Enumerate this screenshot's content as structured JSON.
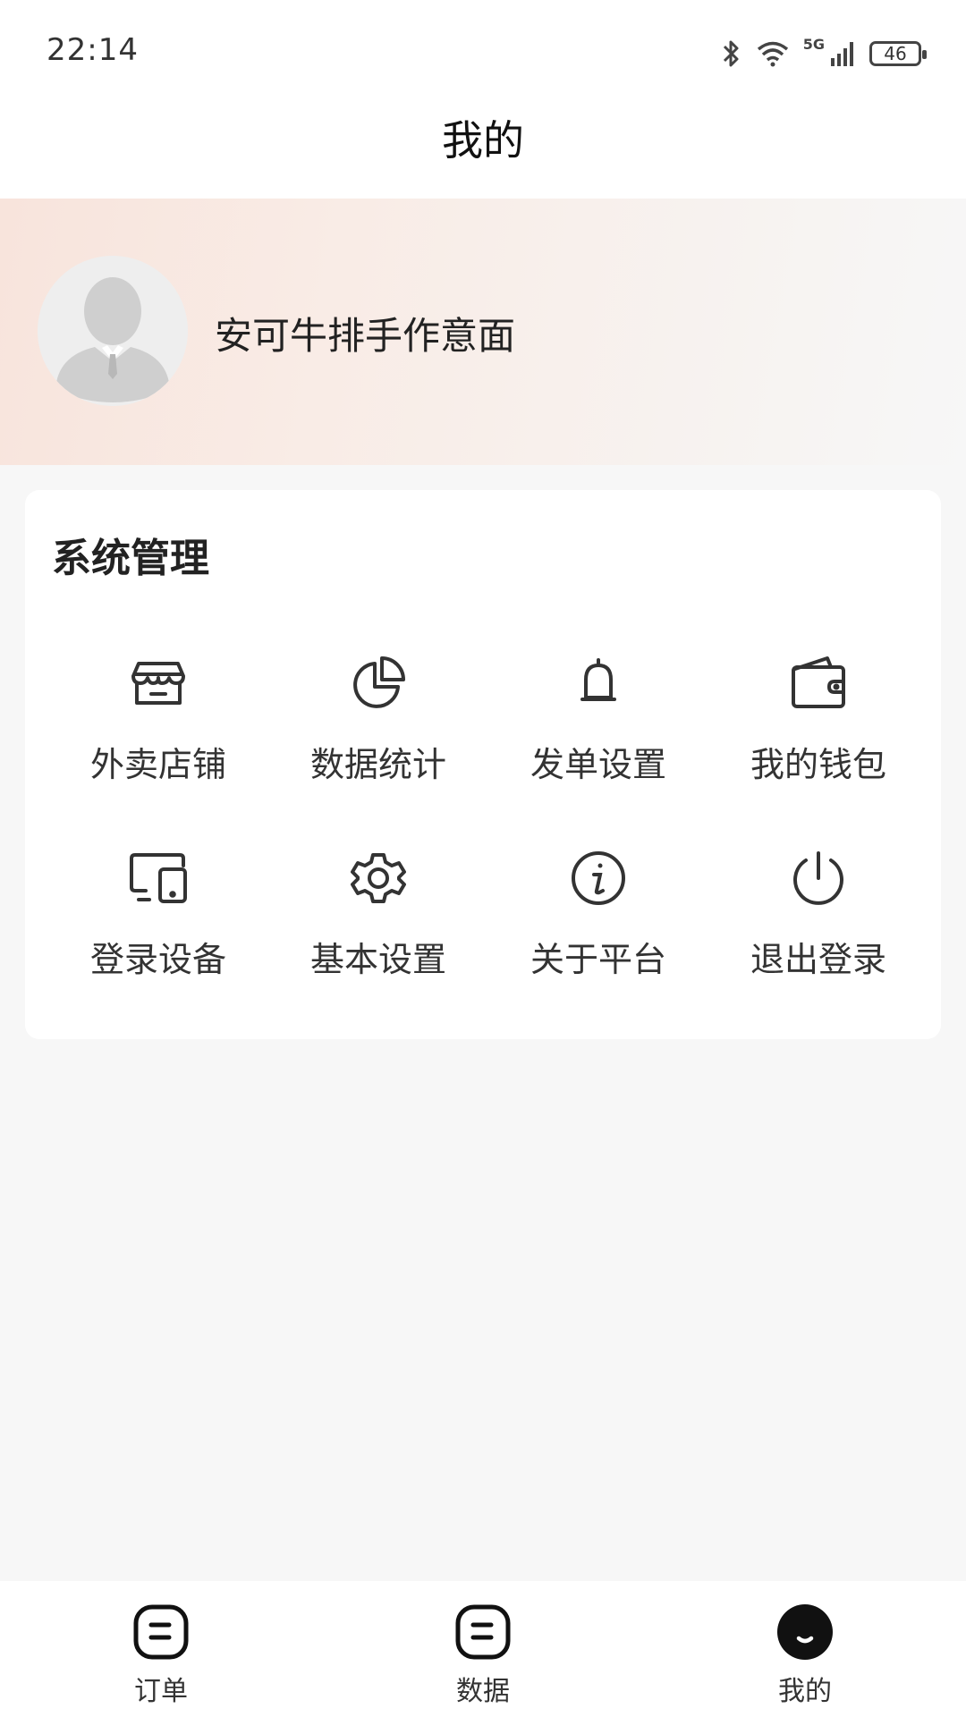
{
  "status_bar": {
    "time": "22:14",
    "network": "5G",
    "battery": "46",
    "icons": [
      "bluetooth-icon",
      "wifi-icon",
      "signal-icon",
      "battery-icon"
    ]
  },
  "nav": {
    "title": "我的"
  },
  "profile": {
    "name": "安可牛排手作意面"
  },
  "card": {
    "title": "系统管理",
    "items": [
      {
        "label": "外卖店铺",
        "icon": "store-icon"
      },
      {
        "label": "数据统计",
        "icon": "pie-chart-icon"
      },
      {
        "label": "发单设置",
        "icon": "bell-icon"
      },
      {
        "label": "我的钱包",
        "icon": "wallet-icon"
      },
      {
        "label": "登录设备",
        "icon": "devices-icon"
      },
      {
        "label": "基本设置",
        "icon": "gear-icon"
      },
      {
        "label": "关于平台",
        "icon": "info-icon"
      },
      {
        "label": "退出登录",
        "icon": "power-icon"
      }
    ]
  },
  "tabbar": {
    "tabs": [
      {
        "label": "订单",
        "icon": "order-tab-icon",
        "active": false
      },
      {
        "label": "数据",
        "icon": "data-tab-icon",
        "active": false
      },
      {
        "label": "我的",
        "icon": "profile-tab-icon",
        "active": true
      }
    ]
  },
  "colors": {
    "icon_stroke": "#333333",
    "page_background": "#f7f7f7",
    "profile_gradient_start": "#f8e4dc"
  }
}
